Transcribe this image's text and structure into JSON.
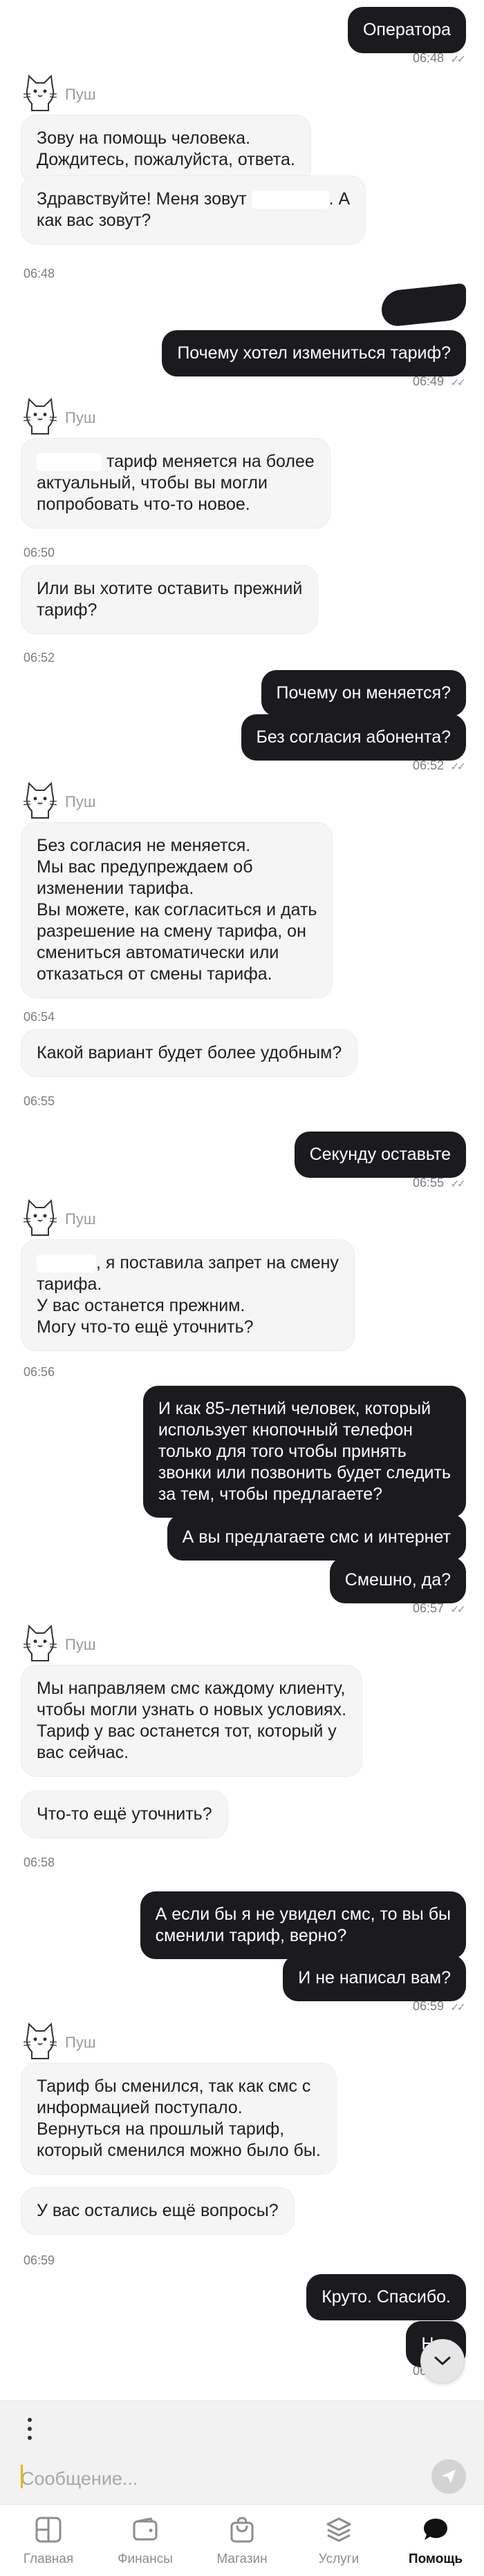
{
  "messages": [
    {
      "text": "Оператора",
      "time": "06:48"
    },
    {
      "bot_name": "Пуш"
    },
    {
      "text": "Зову на помощь человека.\nДождитесь, пожалуйста, ответа."
    },
    {
      "text_a": "Здравствуйте! Меня зовут ",
      "text_b": ". А\nкак вас зовут?",
      "time": "06:48"
    },
    {
      "text": "Почему хотел измениться тариф?",
      "time": "06:49"
    },
    {
      "bot_name": "Пуш"
    },
    {
      "text": " тариф меняется на более\nактуальный, чтобы вы могли\nпопробовать что-то новое.",
      "time": "06:50"
    },
    {
      "text": "Или вы хотите оставить прежний\nтариф?",
      "time": "06:52"
    },
    {
      "text": "Почему он меняется?"
    },
    {
      "text": "Без согласия абонента?",
      "time": "06:52"
    },
    {
      "bot_name": "Пуш"
    },
    {
      "text": "Без согласия не меняется.\nМы вас предупреждаем об\nизменении тарифа.\nВы можете, как согласиться и дать\nразрешение на смену тарифа, он\nсмениться автоматически или\nотказаться от смены тарифа.",
      "time": "06:54"
    },
    {
      "text": "Какой вариант будет более удобным?",
      "time": "06:55"
    },
    {
      "text": "Секунду оставьте",
      "time": "06:55"
    },
    {
      "bot_name": "Пуш"
    },
    {
      "text": ", я поставила запрет на смену\nтарифа.\nУ вас останется прежним.\nМогу что-то ещё уточнить?",
      "time": "06:56"
    },
    {
      "text": "И как 85-летний человек, который\nиспользует кнопочный телефон\nтолько для того чтобы принять\nзвонки или позвонить будет следить\nза тем, чтобы предлагаете?"
    },
    {
      "text": "А вы предлагаете смс и интернет"
    },
    {
      "text": "Смешно, да?",
      "time": "06:57"
    },
    {
      "bot_name": "Пуш"
    },
    {
      "text": "Мы направляем смс каждому клиенту,\nчтобы могли узнать о новых условиях.\nТариф у вас останется тот, который у\nвас сейчас."
    },
    {
      "text": "Что-то ещё уточнить?",
      "time": "06:58"
    },
    {
      "text": "А если бы я не увидел смс, то вы бы\nсменили тариф, верно?"
    },
    {
      "text": "И не написал вам?",
      "time": "06:59"
    },
    {
      "bot_name": "Пуш"
    },
    {
      "text": "Тариф бы сменился, так как смс с\nинформацией поступало.\nВернуться на прошлый тариф,\nкоторый сменился можно было бы."
    },
    {
      "text": "У вас остались ещё вопросы?",
      "time": "06:59"
    },
    {
      "text": "Круто. Спасибо."
    },
    {
      "text": "Нет",
      "time": "06:59"
    }
  ],
  "composer": {
    "placeholder": "Сообщение..."
  },
  "tabs": [
    {
      "label": "Главная",
      "icon": "home-grid-icon"
    },
    {
      "label": "Финансы",
      "icon": "wallet-icon"
    },
    {
      "label": "Магазин",
      "icon": "shopping-bag-icon"
    },
    {
      "label": "Услуги",
      "icon": "layers-icon"
    },
    {
      "label": "Помощь",
      "icon": "chat-bubble-icon",
      "active": true
    }
  ],
  "colors": {
    "outgoing_bubble": "#1b1b1f",
    "incoming_bubble": "#f5f5f5",
    "caret": "#f0b400"
  }
}
